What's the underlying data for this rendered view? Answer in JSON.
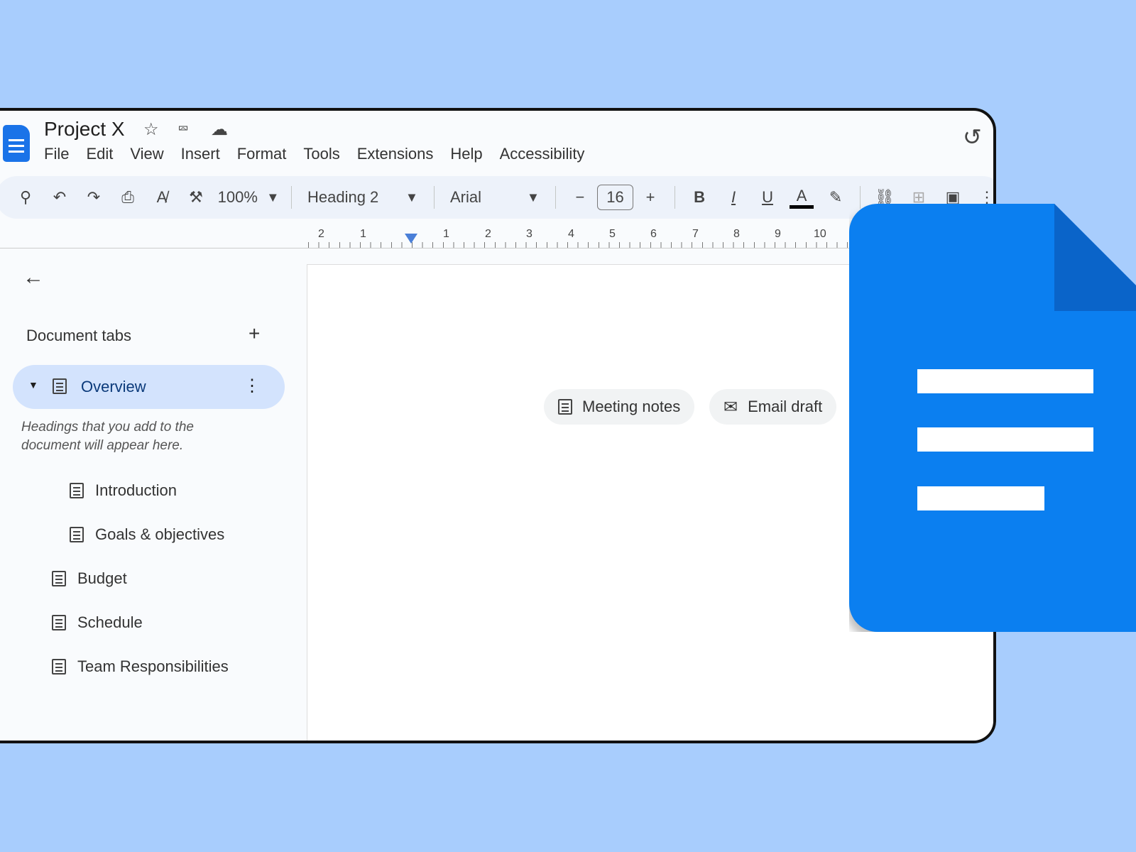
{
  "title": "Project X",
  "menu": [
    "File",
    "Edit",
    "View",
    "Insert",
    "Format",
    "Tools",
    "Extensions",
    "Help",
    "Accessibility"
  ],
  "toolbar": {
    "zoom": "100%",
    "style": "Heading 2",
    "font": "Arial",
    "font_size": "16",
    "bold": "B",
    "italic": "I",
    "underline": "U",
    "text_color": "A"
  },
  "ruler": [
    "2",
    "1",
    "1",
    "2",
    "3",
    "4",
    "5",
    "6",
    "7",
    "8",
    "9",
    "10"
  ],
  "sidebar": {
    "header": "Document tabs",
    "active_tab": "Overview",
    "hint": "Headings that you add to the document will appear here.",
    "items": [
      {
        "label": "Introduction"
      },
      {
        "label": "Goals & objectives"
      },
      {
        "label": "Budget"
      },
      {
        "label": "Schedule"
      },
      {
        "label": "Team Responsibilities"
      }
    ]
  },
  "chips": [
    "Meeting notes",
    "Email draft"
  ],
  "colors": {
    "background": "#a8cdfd",
    "brand": "#0b7ff0",
    "pill": "#d3e3fd"
  }
}
